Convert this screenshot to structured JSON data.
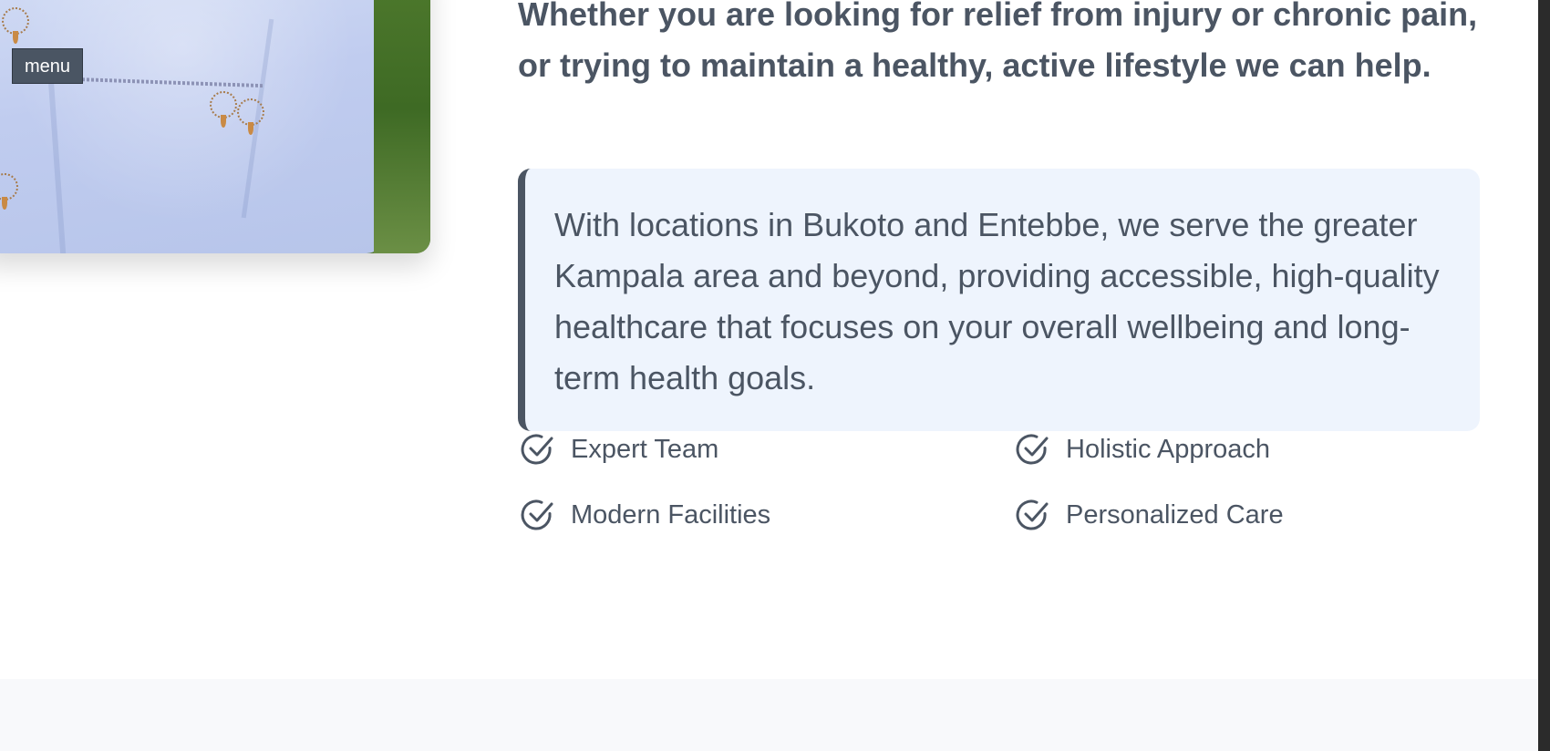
{
  "overlay": {
    "menu_label": "menu"
  },
  "about": {
    "lead": "Whether you are looking for relief from injury or chronic pain, or trying to maintain a healthy, active lifestyle we can help.",
    "quote": "With locations in Bukoto and Entebbe, we serve the greater Kampala area and beyond, providing accessible, high-quality healthcare that focuses on your overall wellbeing and long-term health goals.",
    "features": [
      {
        "label": "Expert Team",
        "icon": "check-circle-icon"
      },
      {
        "label": "Holistic Approach",
        "icon": "check-circle-icon"
      },
      {
        "label": "Modern Facilities",
        "icon": "check-circle-icon"
      },
      {
        "label": "Personalized Care",
        "icon": "check-circle-icon"
      }
    ]
  },
  "colors": {
    "text": "#4b5563",
    "quote_bg": "#eef4fd",
    "quote_border": "#4b5563",
    "footer_band": "#f8f9fb"
  }
}
